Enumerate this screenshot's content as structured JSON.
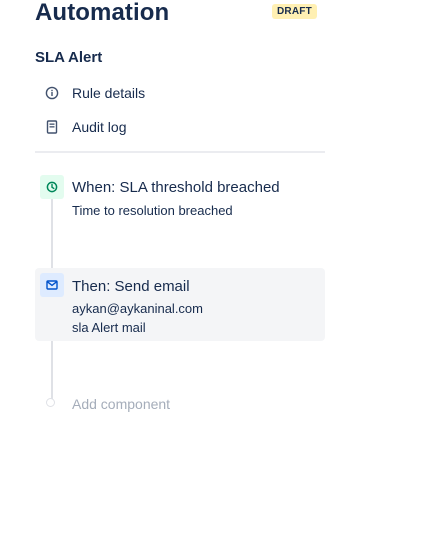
{
  "header": {
    "title": "Automation",
    "badge": "DRAFT"
  },
  "rule": {
    "name": "SLA Alert"
  },
  "menu": {
    "items": [
      {
        "label": "Rule details",
        "icon": "info-icon"
      },
      {
        "label": "Audit log",
        "icon": "document-icon"
      }
    ]
  },
  "components": {
    "trigger": {
      "icon": "clock-icon",
      "title": "When: SLA threshold breached",
      "detail": "Time to resolution breached",
      "icon_color": "#00875a",
      "icon_bg": "#e3fcef"
    },
    "action": {
      "icon": "mail-icon",
      "title": "Then: Send email",
      "details": [
        "aykan@aykaninal.com",
        "sla Alert mail"
      ],
      "icon_color": "#0052cc",
      "icon_bg": "#deebff"
    }
  },
  "add_component": {
    "label": "Add component"
  }
}
